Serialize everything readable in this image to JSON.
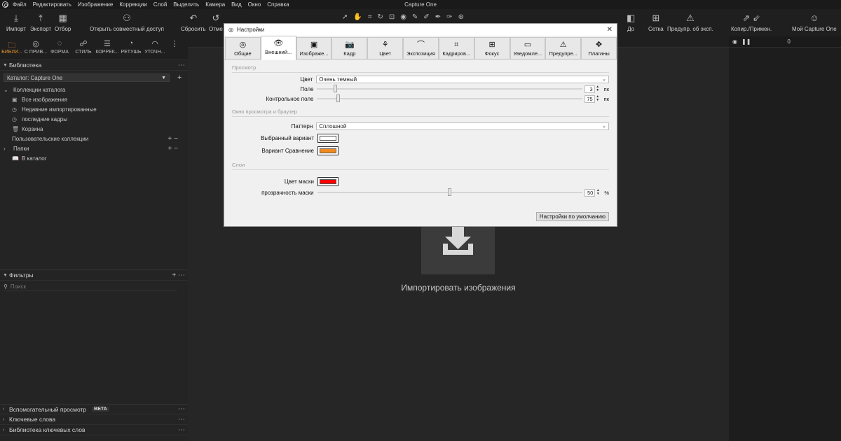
{
  "app": {
    "title": "Capture One"
  },
  "menu": [
    "Файл",
    "Редактировать",
    "Изображение",
    "Коррекции",
    "Слой",
    "Выделить",
    "Камера",
    "Вид",
    "Окно",
    "Справка"
  ],
  "toolbar": {
    "left": [
      {
        "label": "Импорт",
        "icon": "import-icon"
      },
      {
        "label": "Экспорт",
        "icon": "export-icon"
      },
      {
        "label": "Отбор",
        "icon": "cull-icon"
      },
      {
        "label": "Открыть совместный доступ",
        "icon": "share-icon"
      },
      {
        "label": "Сбросить",
        "icon": "reset-icon"
      },
      {
        "label": "Отме",
        "icon": "undo-icon"
      }
    ],
    "right": [
      {
        "label": "До",
        "icon": "before-icon"
      },
      {
        "label": "Сетка",
        "icon": "grid-icon"
      },
      {
        "label": "Предупр. об эксп.",
        "icon": "warning-icon"
      },
      {
        "label": "Копир./Примен.",
        "icon": "copy-apply-icon"
      },
      {
        "label": "Мой Capture One",
        "icon": "user-icon"
      }
    ]
  },
  "tooltabs": [
    {
      "label": "БИБЛИ...",
      "active": true
    },
    {
      "label": "С ПРИВ..."
    },
    {
      "label": "ФОРМА"
    },
    {
      "label": "СТИЛЬ"
    },
    {
      "label": "КОРРЕК..."
    },
    {
      "label": "РЕТУШЬ"
    },
    {
      "label": "УТОЧН..."
    }
  ],
  "library": {
    "title": "Библиотека",
    "catalog": "Каталог: Capture One",
    "collections_title": "Коллекции каталога",
    "collections": [
      "Все изображения",
      "Недавние импортированные",
      "последние кадры",
      "Корзина"
    ],
    "user_collections": "Пользовательские коллекции",
    "folders_title": "Папки",
    "folders": [
      "В каталог"
    ]
  },
  "filters": {
    "title": "Фильтры",
    "search_placeholder": "Поиск"
  },
  "bottom_panels": [
    {
      "label": "Вспомогательный просмотр",
      "badge": "BETA"
    },
    {
      "label": "Ключевые слова"
    },
    {
      "label": "Библиотека ключевых слов"
    }
  ],
  "viewer": {
    "import_text": "Импортировать изображения"
  },
  "rightpanel": {
    "value": "0"
  },
  "dialog": {
    "title": "Настройки",
    "tabs": [
      "Общие",
      "Внешний...",
      "Изображе...",
      "Кадр",
      "Цвет",
      "Экспозиция",
      "Кадриров...",
      "Фокус",
      "Уведомле...",
      "Предупре...",
      "Плагины"
    ],
    "active_tab": 1,
    "sections": {
      "preview": "Просмотр",
      "window": "Окно просмотра и браузер",
      "layers": "Слои"
    },
    "color_label": "Цвет",
    "color_value": "Очень темный",
    "margin_label": "Поле",
    "margin_value": "3",
    "margin_unit": "пк",
    "margin_level": 0.07,
    "contact_label": "Контрольное поле",
    "contact_value": "75",
    "contact_unit": "пк",
    "contact_level": 0.08,
    "pattern_label": "Паттерн",
    "pattern_value": "Сплошной",
    "selected_label": "Выбранный вариант",
    "selected_color": "#ffffff",
    "compare_label": "Вариант Сравнение",
    "compare_color": "#f08a1e",
    "mask_label": "Цвет маски",
    "mask_color": "#ff0000",
    "opacity_label": "прозрачность маски",
    "opacity_value": "50",
    "opacity_unit": "%",
    "opacity_level": 0.5,
    "defaults_button": "Настройки по умолчанию"
  },
  "colors": {
    "accent": "#e8932f"
  }
}
